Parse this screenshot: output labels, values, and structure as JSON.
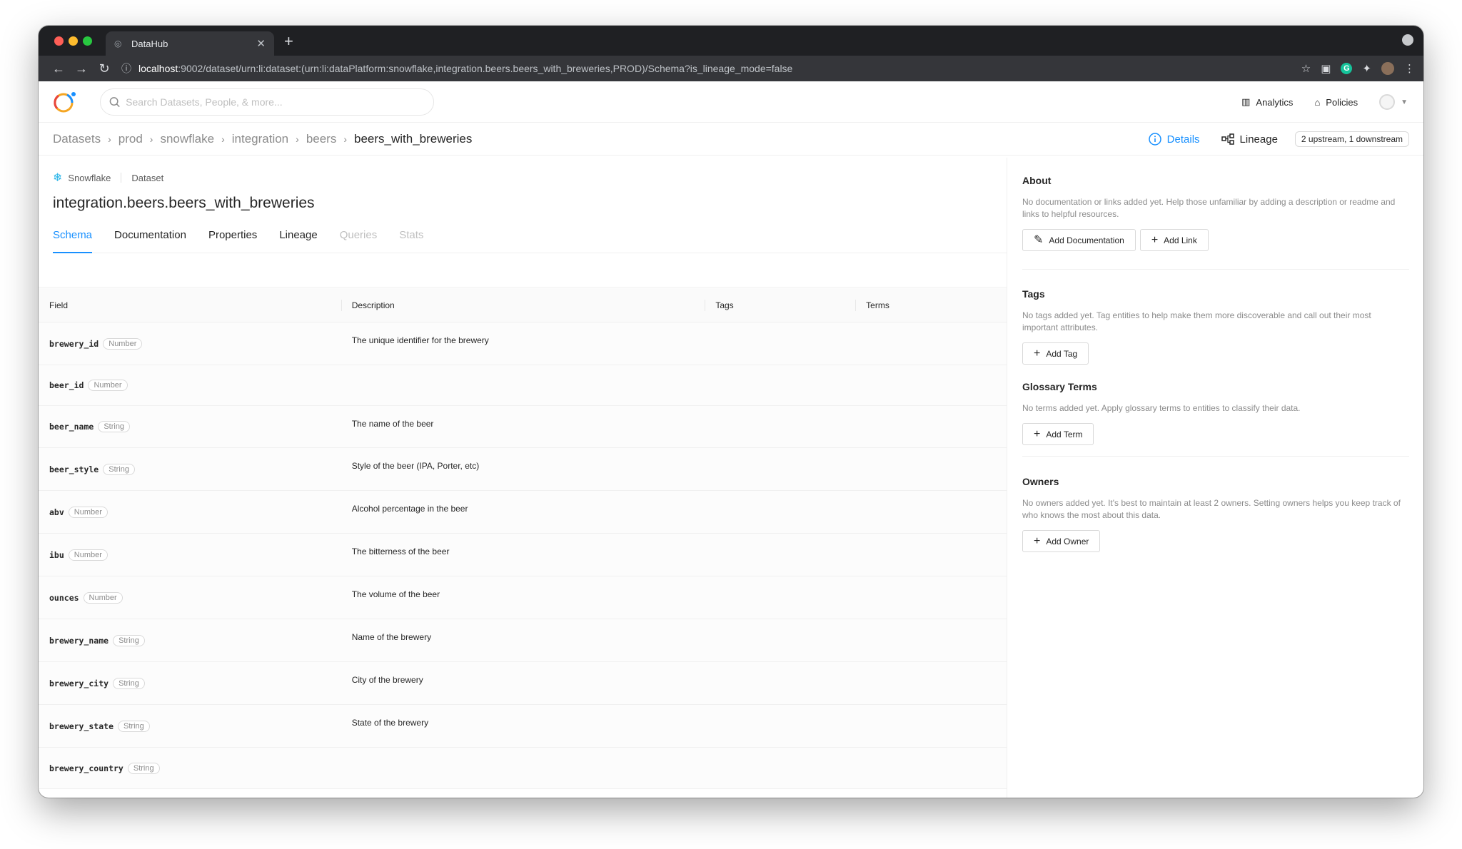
{
  "browser": {
    "tab_title": "DataHub",
    "url_host": "localhost",
    "url_rest": ":9002/dataset/urn:li:dataset:(urn:li:dataPlatform:snowflake,integration.beers.beers_with_breweries,PROD)/Schema?is_lineage_mode=false"
  },
  "header": {
    "search_placeholder": "Search Datasets, People, & more...",
    "analytics": "Analytics",
    "policies": "Policies"
  },
  "breadcrumb": [
    "Datasets",
    "prod",
    "snowflake",
    "integration",
    "beers",
    "beers_with_breweries"
  ],
  "entity_nav": {
    "details": "Details",
    "lineage": "Lineage",
    "lineage_counts": "2 upstream, 1 downstream"
  },
  "dataset": {
    "platform": "Snowflake",
    "entity_type": "Dataset",
    "name": "integration.beers.beers_with_breweries"
  },
  "tabs": [
    "Schema",
    "Documentation",
    "Properties",
    "Lineage",
    "Queries",
    "Stats"
  ],
  "schema": {
    "columns": [
      "Field",
      "Description",
      "Tags",
      "Terms"
    ],
    "rows": [
      {
        "field": "brewery_id",
        "type": "Number",
        "description": "The unique identifier for the brewery"
      },
      {
        "field": "beer_id",
        "type": "Number",
        "description": ""
      },
      {
        "field": "beer_name",
        "type": "String",
        "description": "The name of the beer"
      },
      {
        "field": "beer_style",
        "type": "String",
        "description": "Style of the beer (IPA, Porter, etc)"
      },
      {
        "field": "abv",
        "type": "Number",
        "description": "Alcohol percentage in the beer"
      },
      {
        "field": "ibu",
        "type": "Number",
        "description": "The bitterness of the beer"
      },
      {
        "field": "ounces",
        "type": "Number",
        "description": "The volume of the beer"
      },
      {
        "field": "brewery_name",
        "type": "String",
        "description": "Name of the brewery"
      },
      {
        "field": "brewery_city",
        "type": "String",
        "description": "City of the brewery"
      },
      {
        "field": "brewery_state",
        "type": "String",
        "description": "State of the brewery"
      },
      {
        "field": "brewery_country",
        "type": "String",
        "description": ""
      }
    ]
  },
  "sidebar": {
    "about": {
      "title": "About",
      "text": "No documentation or links added yet. Help those unfamiliar by adding a description or readme and links to helpful resources.",
      "add_documentation": "Add Documentation",
      "add_link": "Add Link"
    },
    "tags": {
      "title": "Tags",
      "text": "No tags added yet. Tag entities to help make them more discoverable and call out their most important attributes.",
      "add_tag": "Add Tag"
    },
    "terms": {
      "title": "Glossary Terms",
      "text": "No terms added yet. Apply glossary terms to entities to classify their data.",
      "add_term": "Add Term"
    },
    "owners": {
      "title": "Owners",
      "text": "No owners added yet. It's best to maintain at least 2 owners. Setting owners helps you keep track of who knows the most about this data.",
      "add_owner": "Add Owner"
    }
  },
  "colors": {
    "accent": "#1890ff",
    "chrome_dark": "#1f2023",
    "chrome_tab": "#35363a"
  }
}
